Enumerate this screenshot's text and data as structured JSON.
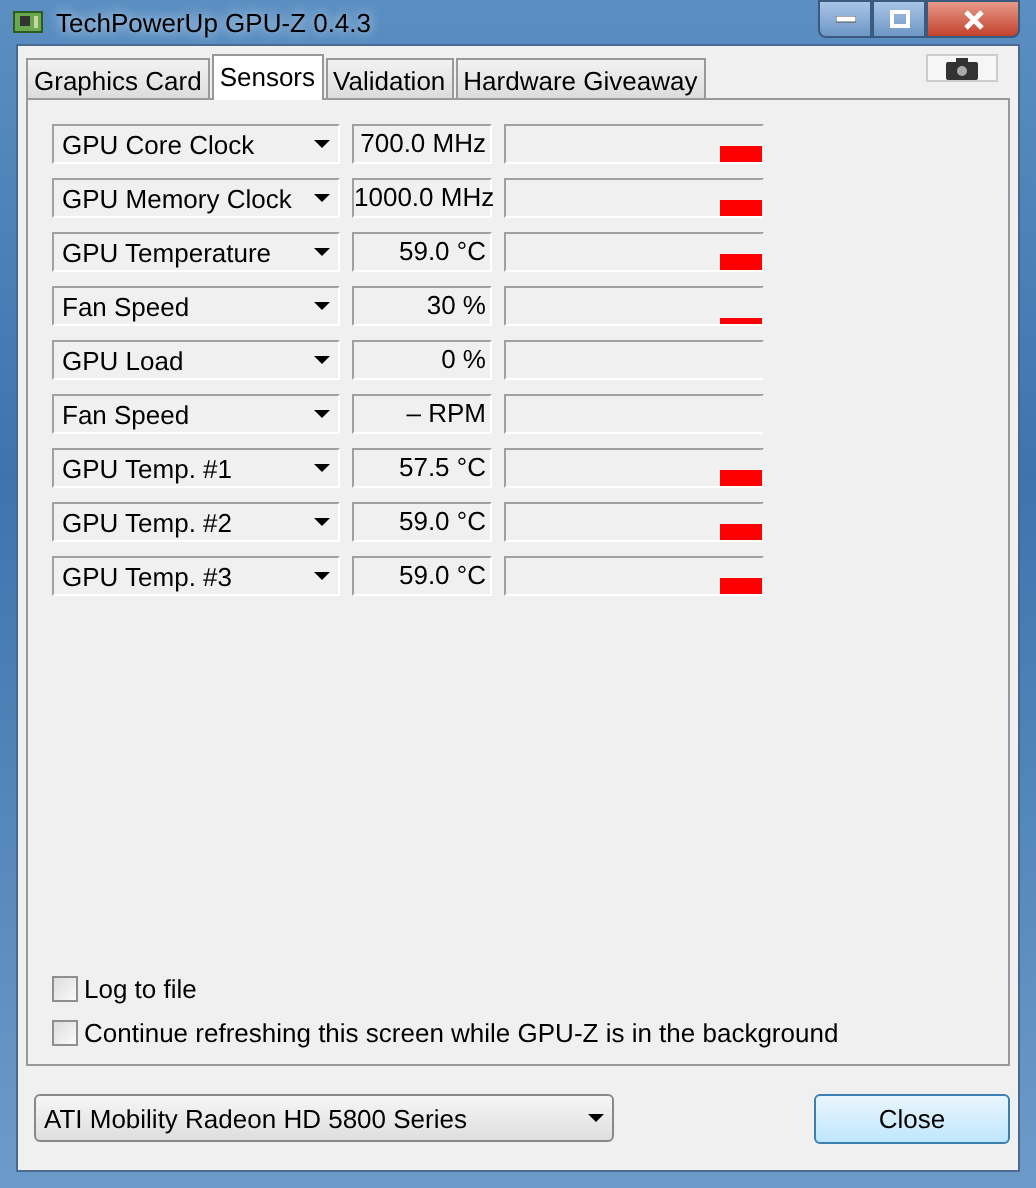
{
  "window": {
    "title": "TechPowerUp GPU-Z 0.4.3"
  },
  "tabs": [
    {
      "label": "Graphics Card",
      "selected": false
    },
    {
      "label": "Sensors",
      "selected": true
    },
    {
      "label": "Validation",
      "selected": false
    },
    {
      "label": "Hardware Giveaway",
      "selected": false
    }
  ],
  "sensors": [
    {
      "name": "GPU Core Clock",
      "reading": "700.0 MHz",
      "kind": "high"
    },
    {
      "name": "GPU Memory Clock",
      "reading": "1000.0 MHz",
      "kind": "high"
    },
    {
      "name": "GPU Temperature",
      "reading": "59.0 °C",
      "kind": "high"
    },
    {
      "name": "Fan Speed",
      "reading": "30 %",
      "kind": "low"
    },
    {
      "name": "GPU Load",
      "reading": "0 %",
      "kind": "empty"
    },
    {
      "name": "Fan Speed",
      "reading": "– RPM",
      "kind": "empty"
    },
    {
      "name": "GPU Temp. #1",
      "reading": "57.5 °C",
      "kind": "high"
    },
    {
      "name": "GPU Temp. #2",
      "reading": "59.0 °C",
      "kind": "high"
    },
    {
      "name": "GPU Temp. #3",
      "reading": "59.0 °C",
      "kind": "high"
    }
  ],
  "options": [
    {
      "label": "Log to file",
      "checked": false
    },
    {
      "label": "Continue refreshing this screen while GPU-Z is in the background",
      "checked": false
    }
  ],
  "device": {
    "value": "ATI Mobility Radeon HD 5800 Series"
  },
  "buttons": [
    "Close"
  ]
}
